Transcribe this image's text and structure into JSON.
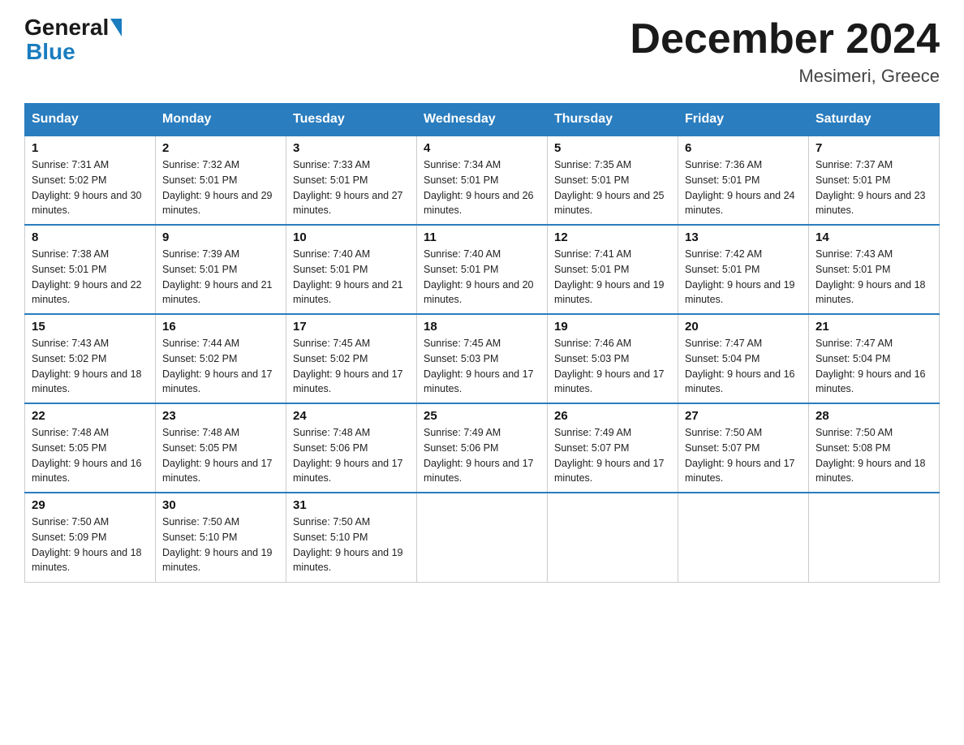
{
  "header": {
    "logo_general": "General",
    "logo_blue": "Blue",
    "month_title": "December 2024",
    "location": "Mesimeri, Greece"
  },
  "weekdays": [
    "Sunday",
    "Monday",
    "Tuesday",
    "Wednesday",
    "Thursday",
    "Friday",
    "Saturday"
  ],
  "weeks": [
    [
      {
        "day": "1",
        "sunrise": "7:31 AM",
        "sunset": "5:02 PM",
        "daylight": "9 hours and 30 minutes."
      },
      {
        "day": "2",
        "sunrise": "7:32 AM",
        "sunset": "5:01 PM",
        "daylight": "9 hours and 29 minutes."
      },
      {
        "day": "3",
        "sunrise": "7:33 AM",
        "sunset": "5:01 PM",
        "daylight": "9 hours and 27 minutes."
      },
      {
        "day": "4",
        "sunrise": "7:34 AM",
        "sunset": "5:01 PM",
        "daylight": "9 hours and 26 minutes."
      },
      {
        "day": "5",
        "sunrise": "7:35 AM",
        "sunset": "5:01 PM",
        "daylight": "9 hours and 25 minutes."
      },
      {
        "day": "6",
        "sunrise": "7:36 AM",
        "sunset": "5:01 PM",
        "daylight": "9 hours and 24 minutes."
      },
      {
        "day": "7",
        "sunrise": "7:37 AM",
        "sunset": "5:01 PM",
        "daylight": "9 hours and 23 minutes."
      }
    ],
    [
      {
        "day": "8",
        "sunrise": "7:38 AM",
        "sunset": "5:01 PM",
        "daylight": "9 hours and 22 minutes."
      },
      {
        "day": "9",
        "sunrise": "7:39 AM",
        "sunset": "5:01 PM",
        "daylight": "9 hours and 21 minutes."
      },
      {
        "day": "10",
        "sunrise": "7:40 AM",
        "sunset": "5:01 PM",
        "daylight": "9 hours and 21 minutes."
      },
      {
        "day": "11",
        "sunrise": "7:40 AM",
        "sunset": "5:01 PM",
        "daylight": "9 hours and 20 minutes."
      },
      {
        "day": "12",
        "sunrise": "7:41 AM",
        "sunset": "5:01 PM",
        "daylight": "9 hours and 19 minutes."
      },
      {
        "day": "13",
        "sunrise": "7:42 AM",
        "sunset": "5:01 PM",
        "daylight": "9 hours and 19 minutes."
      },
      {
        "day": "14",
        "sunrise": "7:43 AM",
        "sunset": "5:01 PM",
        "daylight": "9 hours and 18 minutes."
      }
    ],
    [
      {
        "day": "15",
        "sunrise": "7:43 AM",
        "sunset": "5:02 PM",
        "daylight": "9 hours and 18 minutes."
      },
      {
        "day": "16",
        "sunrise": "7:44 AM",
        "sunset": "5:02 PM",
        "daylight": "9 hours and 17 minutes."
      },
      {
        "day": "17",
        "sunrise": "7:45 AM",
        "sunset": "5:02 PM",
        "daylight": "9 hours and 17 minutes."
      },
      {
        "day": "18",
        "sunrise": "7:45 AM",
        "sunset": "5:03 PM",
        "daylight": "9 hours and 17 minutes."
      },
      {
        "day": "19",
        "sunrise": "7:46 AM",
        "sunset": "5:03 PM",
        "daylight": "9 hours and 17 minutes."
      },
      {
        "day": "20",
        "sunrise": "7:47 AM",
        "sunset": "5:04 PM",
        "daylight": "9 hours and 16 minutes."
      },
      {
        "day": "21",
        "sunrise": "7:47 AM",
        "sunset": "5:04 PM",
        "daylight": "9 hours and 16 minutes."
      }
    ],
    [
      {
        "day": "22",
        "sunrise": "7:48 AM",
        "sunset": "5:05 PM",
        "daylight": "9 hours and 16 minutes."
      },
      {
        "day": "23",
        "sunrise": "7:48 AM",
        "sunset": "5:05 PM",
        "daylight": "9 hours and 17 minutes."
      },
      {
        "day": "24",
        "sunrise": "7:48 AM",
        "sunset": "5:06 PM",
        "daylight": "9 hours and 17 minutes."
      },
      {
        "day": "25",
        "sunrise": "7:49 AM",
        "sunset": "5:06 PM",
        "daylight": "9 hours and 17 minutes."
      },
      {
        "day": "26",
        "sunrise": "7:49 AM",
        "sunset": "5:07 PM",
        "daylight": "9 hours and 17 minutes."
      },
      {
        "day": "27",
        "sunrise": "7:50 AM",
        "sunset": "5:07 PM",
        "daylight": "9 hours and 17 minutes."
      },
      {
        "day": "28",
        "sunrise": "7:50 AM",
        "sunset": "5:08 PM",
        "daylight": "9 hours and 18 minutes."
      }
    ],
    [
      {
        "day": "29",
        "sunrise": "7:50 AM",
        "sunset": "5:09 PM",
        "daylight": "9 hours and 18 minutes."
      },
      {
        "day": "30",
        "sunrise": "7:50 AM",
        "sunset": "5:10 PM",
        "daylight": "9 hours and 19 minutes."
      },
      {
        "day": "31",
        "sunrise": "7:50 AM",
        "sunset": "5:10 PM",
        "daylight": "9 hours and 19 minutes."
      },
      null,
      null,
      null,
      null
    ]
  ]
}
